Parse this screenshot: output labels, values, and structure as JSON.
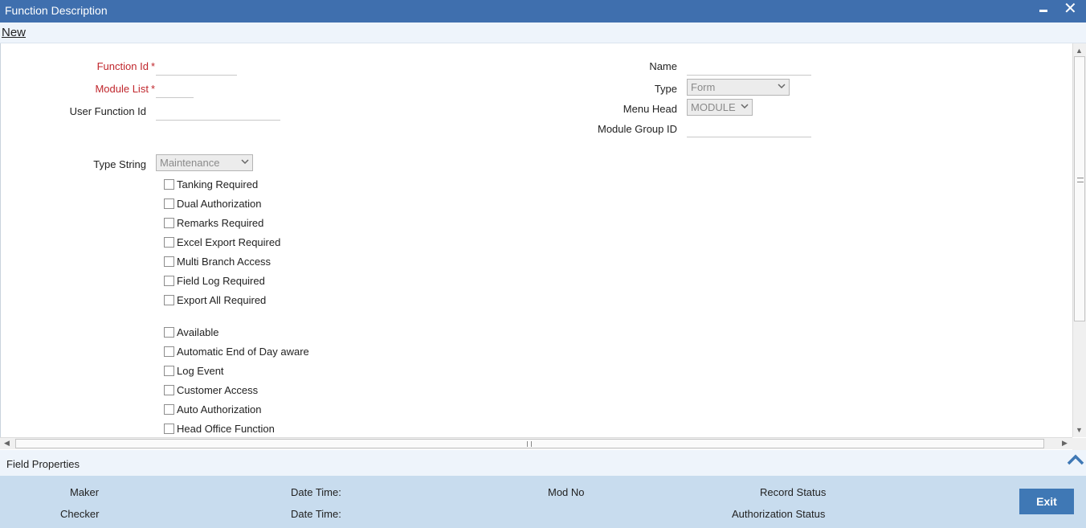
{
  "window": {
    "title": "Function Description",
    "minimize_icon": "minimize-icon",
    "close_icon": "close-icon"
  },
  "menu": {
    "new_label": "New"
  },
  "form": {
    "function_id": {
      "label": "Function Id",
      "value": ""
    },
    "module_list": {
      "label": "Module List",
      "value": ""
    },
    "user_function_id": {
      "label": "User Function Id",
      "value": ""
    },
    "name": {
      "label": "Name",
      "value": ""
    },
    "type": {
      "label": "Type",
      "selected": "Form"
    },
    "menu_head": {
      "label": "Menu Head",
      "selected": "MODULE"
    },
    "module_group_id": {
      "label": "Module Group ID",
      "value": ""
    },
    "type_string": {
      "label": "Type String",
      "selected": "Maintenance"
    },
    "required_marker": "*"
  },
  "checkboxes": {
    "group1": [
      {
        "label": "Tanking Required",
        "checked": false
      },
      {
        "label": "Dual Authorization",
        "checked": false
      },
      {
        "label": "Remarks Required",
        "checked": false
      },
      {
        "label": "Excel Export Required",
        "checked": false
      },
      {
        "label": "Multi Branch Access",
        "checked": false
      },
      {
        "label": "Field Log Required",
        "checked": false
      },
      {
        "label": "Export All Required",
        "checked": false
      }
    ],
    "group2": [
      {
        "label": "Available",
        "checked": false
      },
      {
        "label": "Automatic End of Day aware",
        "checked": false
      },
      {
        "label": "Log Event",
        "checked": false
      },
      {
        "label": "Customer Access",
        "checked": false
      },
      {
        "label": "Auto Authorization",
        "checked": false
      },
      {
        "label": "Head Office Function",
        "checked": false
      }
    ]
  },
  "field_properties": {
    "label": "Field Properties"
  },
  "footer": {
    "maker": "Maker",
    "checker": "Checker",
    "date_time_1": "Date Time:",
    "date_time_2": "Date Time:",
    "mod_no": "Mod No",
    "record_status": "Record Status",
    "authorization_status": "Authorization Status",
    "exit_label": "Exit"
  },
  "colors": {
    "titlebar": "#3f6fae",
    "required_label": "#c0262c",
    "footer_bg": "#c8dcee",
    "exit_button": "#3f78b5"
  }
}
